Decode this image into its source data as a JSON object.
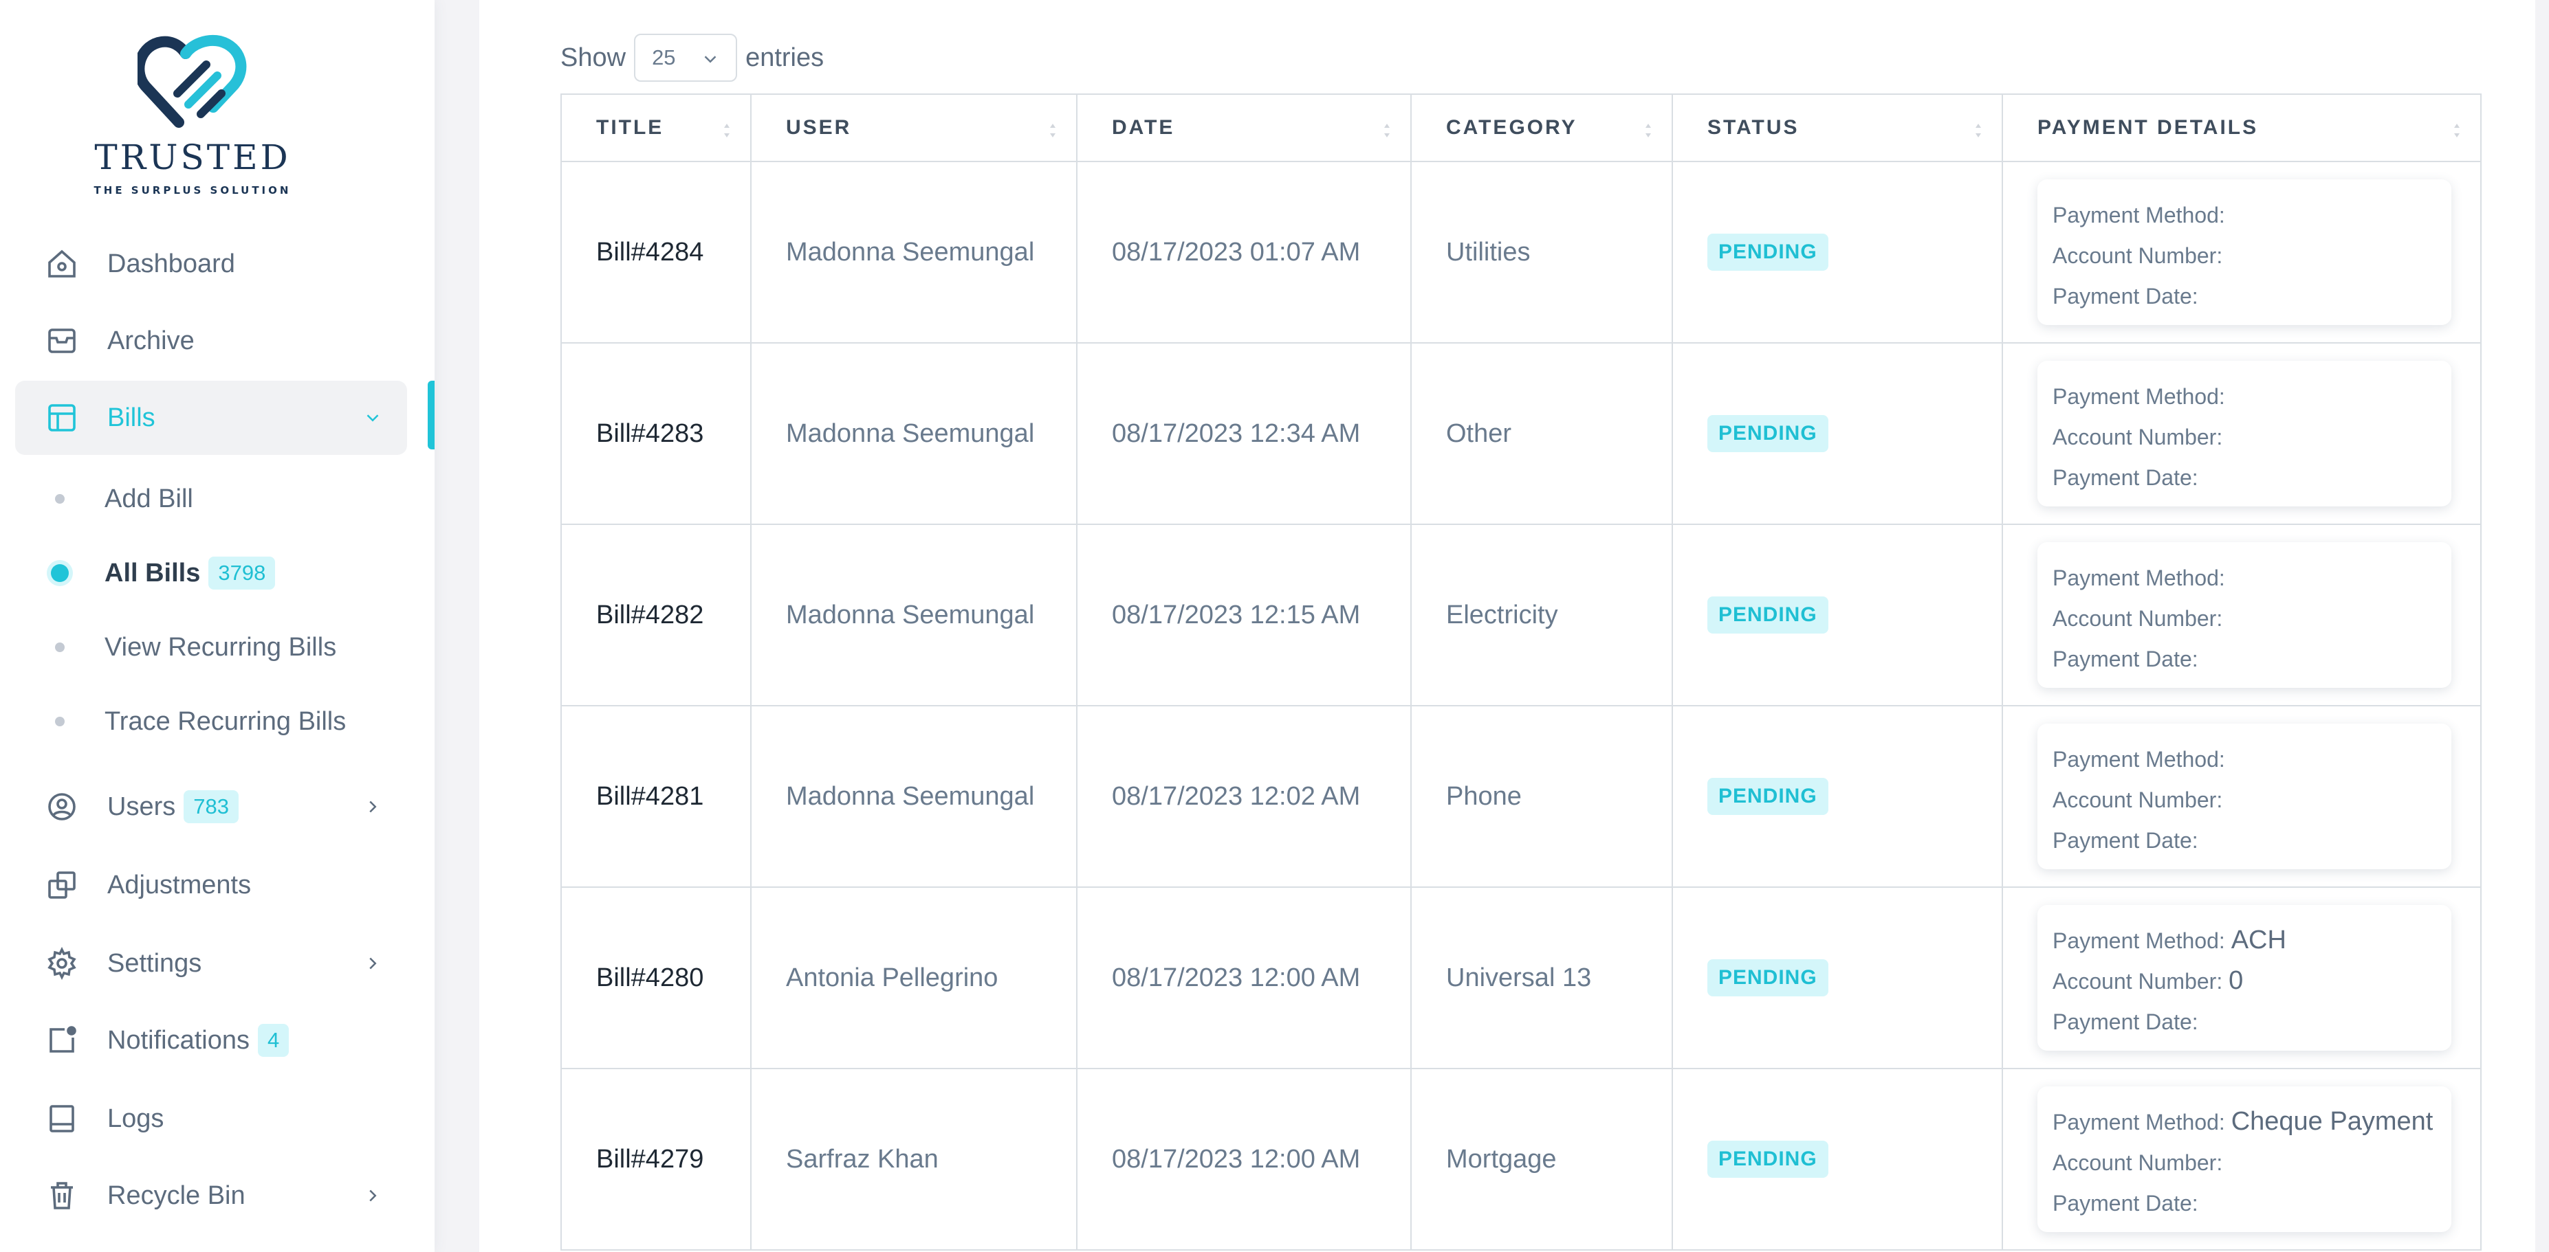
{
  "brand": {
    "name": "TRUSTED",
    "tagline": "THE SURPLUS SOLUTION"
  },
  "menu": {
    "dashboard": "Dashboard",
    "archive": "Archive",
    "bills": "Bills",
    "users": "Users",
    "users_badge": "783",
    "adjustments": "Adjustments",
    "settings": "Settings",
    "notifications": "Notifications",
    "notifications_badge": "4",
    "logs": "Logs",
    "recycle_bin": "Recycle Bin"
  },
  "bills_submenu": {
    "add": "Add Bill",
    "all": "All Bills",
    "all_badge": "3798",
    "view_recurring": "View Recurring Bills",
    "trace_recurring": "Trace Recurring Bills"
  },
  "entries": {
    "show": "Show",
    "value": "25",
    "suffix": "entries"
  },
  "table": {
    "headers": [
      "TITLE",
      "USER",
      "DATE",
      "CATEGORY",
      "STATUS",
      "PAYMENT DETAILS"
    ],
    "payment_labels": {
      "method": "Payment Method:",
      "account": "Account Number:",
      "date": "Payment Date:"
    },
    "rows": [
      {
        "title": "Bill#4284",
        "user": "Madonna Seemungal",
        "date": "08/17/2023 01:07 AM",
        "category": "Utilities",
        "status": "PENDING",
        "method": "",
        "account": "",
        "pay_date": ""
      },
      {
        "title": "Bill#4283",
        "user": "Madonna Seemungal",
        "date": "08/17/2023 12:34 AM",
        "category": "Other",
        "status": "PENDING",
        "method": "",
        "account": "",
        "pay_date": ""
      },
      {
        "title": "Bill#4282",
        "user": "Madonna Seemungal",
        "date": "08/17/2023 12:15 AM",
        "category": "Electricity",
        "status": "PENDING",
        "method": "",
        "account": "",
        "pay_date": ""
      },
      {
        "title": "Bill#4281",
        "user": "Madonna Seemungal",
        "date": "08/17/2023 12:02 AM",
        "category": "Phone",
        "status": "PENDING",
        "method": "",
        "account": "",
        "pay_date": ""
      },
      {
        "title": "Bill#4280",
        "user": "Antonia Pellegrino",
        "date": "08/17/2023 12:00 AM",
        "category": "Universal 13",
        "status": "PENDING",
        "method": "ACH",
        "account": "0",
        "pay_date": ""
      },
      {
        "title": "Bill#4279",
        "user": "Sarfraz Khan",
        "date": "08/17/2023 12:00 AM",
        "category": "Mortgage",
        "status": "PENDING",
        "method": "Cheque Payment",
        "account": "",
        "pay_date": ""
      }
    ]
  },
  "colors": {
    "accent": "#20c4d8",
    "badge_bg": "#d4f6fa",
    "text": "#697a8d",
    "brand_navy": "#1b3555"
  },
  "icons": {
    "dashboard": "home-icon",
    "archive": "archive-box-icon",
    "bills": "layout-icon",
    "users": "user-circle-icon",
    "adjustments": "copy-icon",
    "settings": "gear-icon",
    "notifications": "notification-icon",
    "logs": "book-icon",
    "recycle_bin": "trash-icon"
  }
}
